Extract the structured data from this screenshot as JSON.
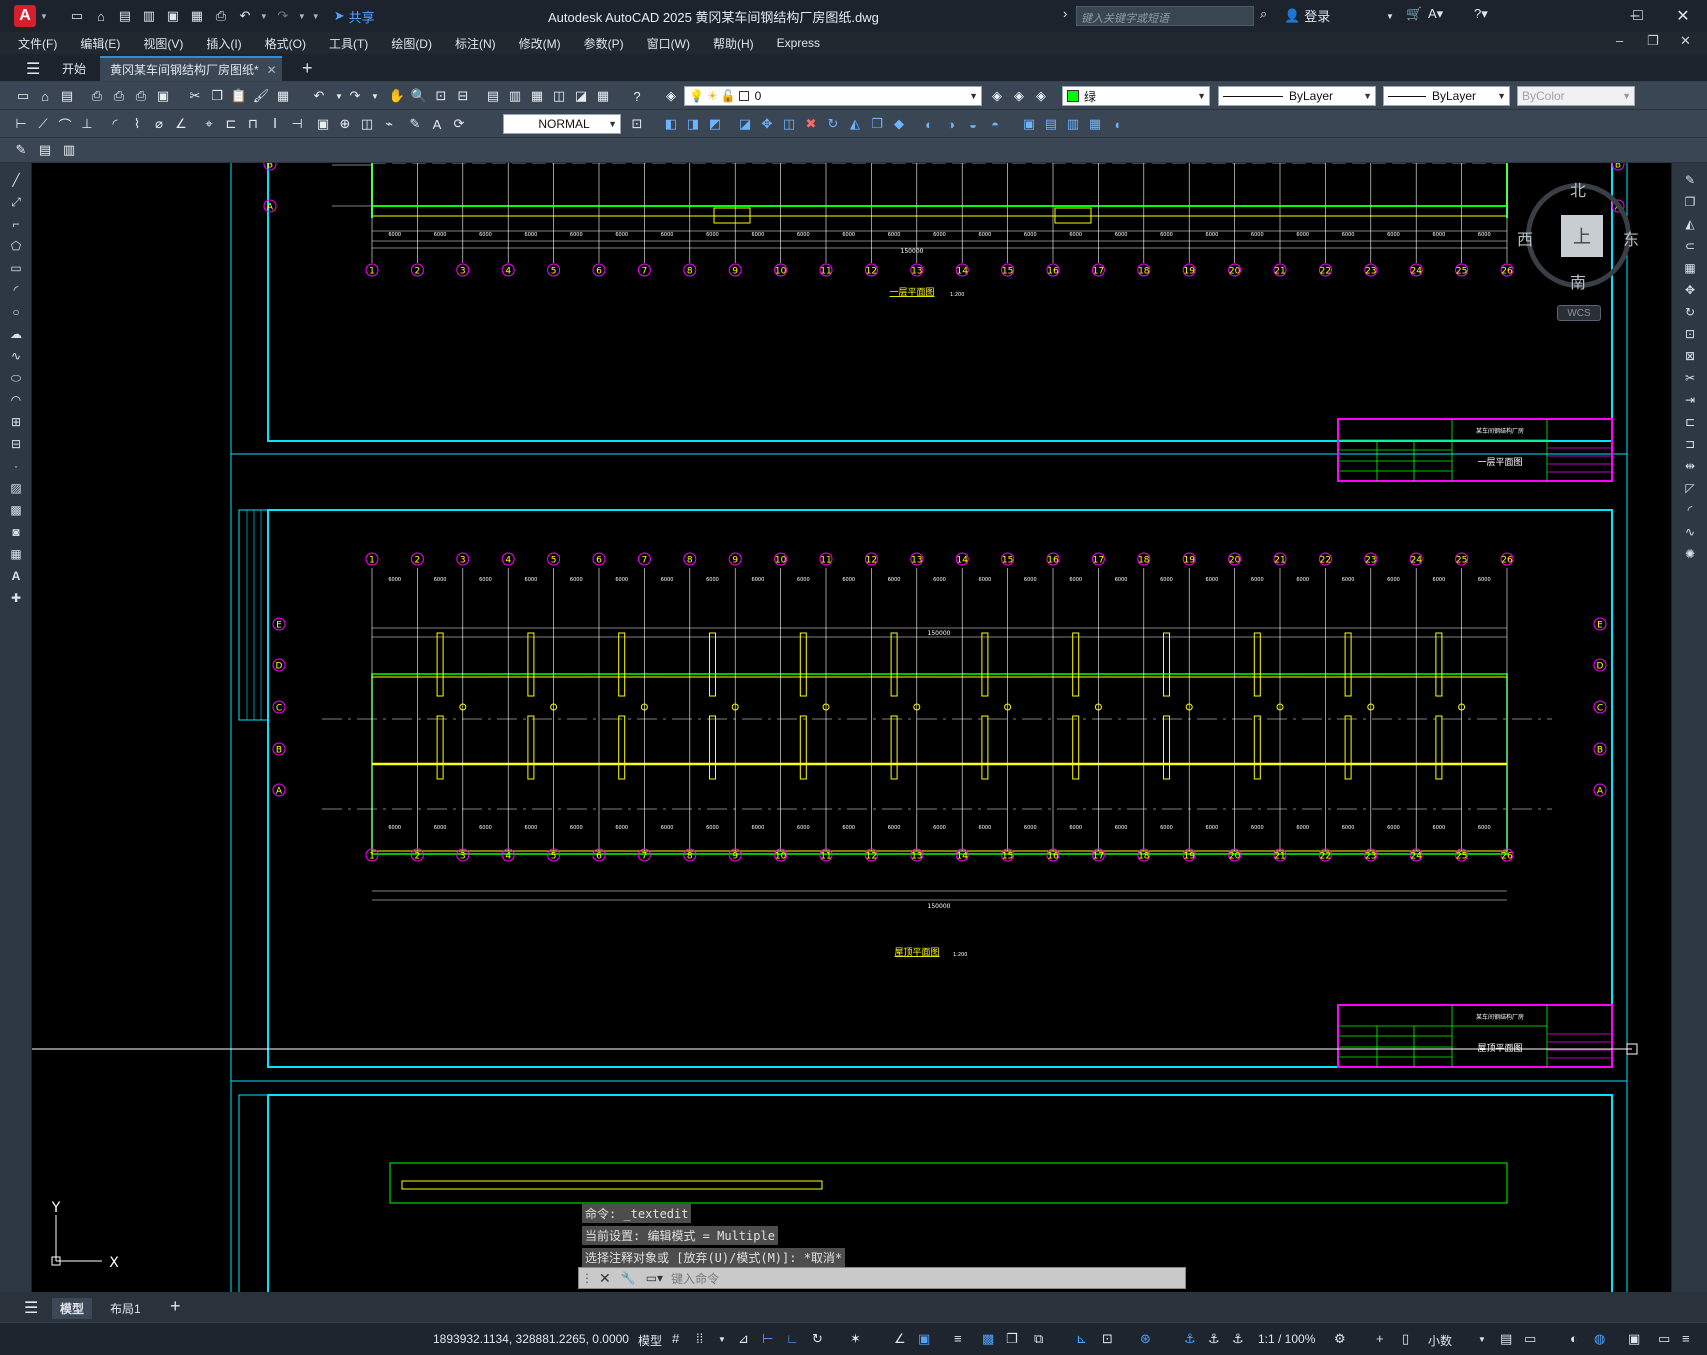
{
  "titlebar": {
    "app_letter": "A",
    "share_label": "共享",
    "title": "Autodesk AutoCAD 2025    黄冈某车间钢结构厂房图纸.dwg",
    "search_placeholder": "键入关键字或短语",
    "login_label": "登录"
  },
  "menu": [
    "文件(F)",
    "编辑(E)",
    "视图(V)",
    "插入(I)",
    "格式(O)",
    "工具(T)",
    "绘图(D)",
    "标注(N)",
    "修改(M)",
    "参数(P)",
    "窗口(W)",
    "帮助(H)",
    "Express"
  ],
  "tabs": {
    "start": "开始",
    "file": "黄冈某车间钢结构厂房图纸*"
  },
  "toolbar": {
    "layer_value": "0",
    "color_value": "绿",
    "linetype_value": "ByLayer",
    "lineweight_value": "ByLayer",
    "plotstyle_value": "ByColor",
    "dimstyle_value": "NORMAL"
  },
  "viewcube": {
    "north": "北",
    "south": "南",
    "east": "东",
    "west": "西",
    "top": "上",
    "wcs": "WCS"
  },
  "ucs": {
    "x": "X",
    "y": "Y"
  },
  "drawings": {
    "plan1_title": "一层平面图",
    "plan2_title": "屋顶平面图",
    "scale": "1:200",
    "total_dim": "150000",
    "bay_dim": "6000",
    "grid_numbers": [
      "1",
      "2",
      "3",
      "4",
      "5",
      "6",
      "7",
      "8",
      "9",
      "10",
      "11",
      "12",
      "13",
      "14",
      "15",
      "16",
      "17",
      "18",
      "19",
      "20",
      "21",
      "22",
      "23",
      "24",
      "25",
      "26"
    ],
    "grid_letters": [
      "E",
      "D",
      "C",
      "B",
      "A"
    ],
    "titleblock_project": "某车间钢结构厂房",
    "titleblock_sheet1": "一层平面图",
    "titleblock_sheet2": "屋顶平面图"
  },
  "command": {
    "history": [
      "命令: _textedit",
      "当前设置: 编辑模式 = Multiple",
      "选择注释对象或 [放弃(U)/模式(M)]: *取消*"
    ],
    "placeholder": "键入命令"
  },
  "layout_tabs": [
    "模型",
    "布局1"
  ],
  "status": {
    "coordinates": "1893932.1134, 328881.2265, 0.0000",
    "model_label": "模型",
    "scale_label": "1:1 / 100%",
    "units_label": "小数"
  },
  "colors": {
    "cyan": "#00e5ff",
    "yellow": "#ffff00",
    "green": "#00ff00",
    "magenta": "#ff00ff",
    "white": "#ffffff"
  }
}
